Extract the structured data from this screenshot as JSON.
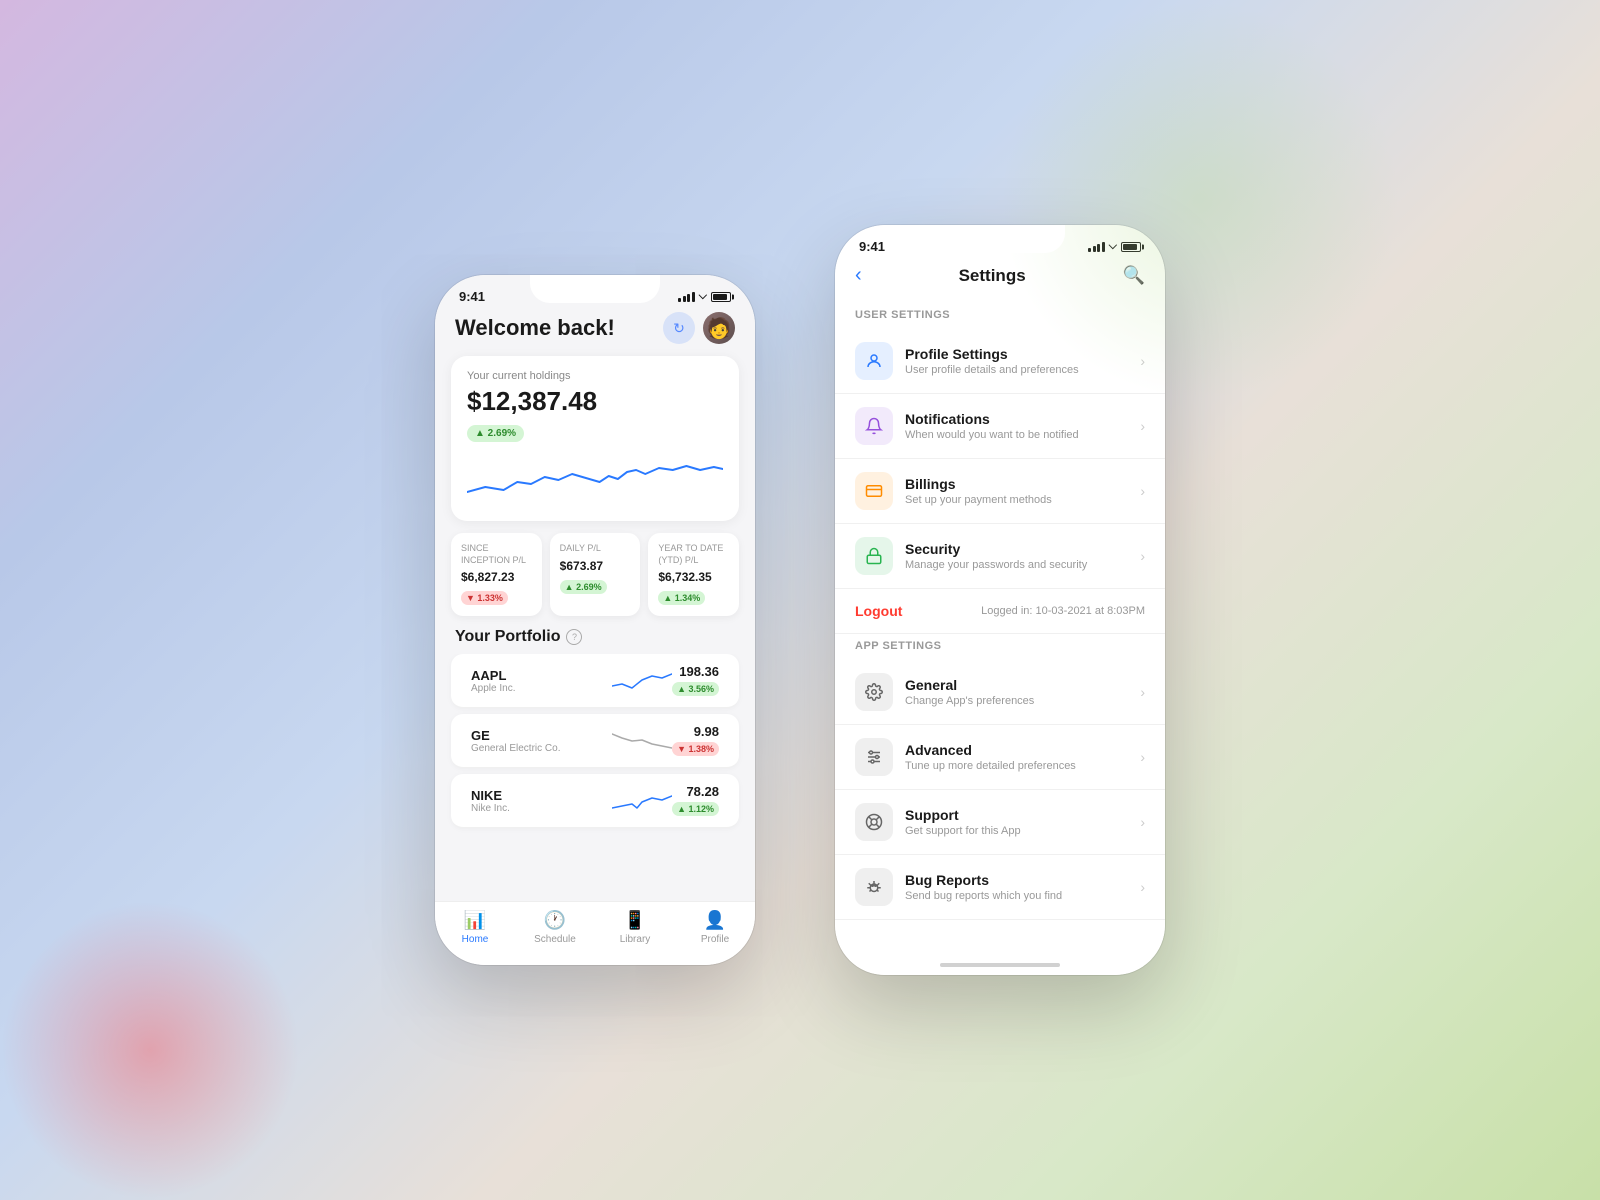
{
  "phone1": {
    "status": {
      "time": "9:41",
      "location_icon": "▸"
    },
    "header": {
      "welcome": "Welcome back!",
      "refresh_icon": "↻"
    },
    "holdings": {
      "label": "Your current holdings",
      "amount": "$12,387.48",
      "change": "▲ 2.69%",
      "change_type": "positive"
    },
    "stats": [
      {
        "label": "SINCE INCEPTION P/L",
        "value": "$6,827.23",
        "change": "▼ 1.33%",
        "type": "negative"
      },
      {
        "label": "DAILY P/L",
        "value": "$673.87",
        "change": "▲ 2.69%",
        "type": "positive"
      },
      {
        "label": "YEAR TO DATE (YTD) P/L",
        "value": "$6,732.35",
        "change": "▲ 1.34%",
        "type": "positive"
      }
    ],
    "portfolio": {
      "title": "Your Portfolio"
    },
    "stocks": [
      {
        "ticker": "AAPL",
        "name": "Apple Inc.",
        "price": "198.36",
        "change": "▲ 3.56%",
        "type": "positive"
      },
      {
        "ticker": "GE",
        "name": "General Electric Co.",
        "price": "9.98",
        "change": "▼ 1.38%",
        "type": "negative"
      },
      {
        "ticker": "NIKE",
        "name": "Nike Inc.",
        "price": "78.28",
        "change": "▲ 1.12%",
        "type": "positive"
      }
    ],
    "bottom_nav": [
      {
        "label": "Home",
        "icon": "📊",
        "active": true
      },
      {
        "label": "Schedule",
        "icon": "🕐",
        "active": false
      },
      {
        "label": "Library",
        "icon": "📱",
        "active": false
      },
      {
        "label": "Profile",
        "icon": "👤",
        "active": false
      }
    ]
  },
  "phone2": {
    "status": {
      "time": "9:41",
      "location_icon": "▸"
    },
    "header": {
      "title": "Settings",
      "back_icon": "‹",
      "search_icon": "⌕"
    },
    "user_settings_label": "USER SETTINGS",
    "app_settings_label": "APP SETTINGS",
    "user_settings": [
      {
        "id": "profile",
        "title": "Profile Settings",
        "subtitle": "User profile details and preferences",
        "icon": "👤",
        "icon_class": "icon-blue"
      },
      {
        "id": "notifications",
        "title": "Notifications",
        "subtitle": "When would you want to be notified",
        "icon": "🔔",
        "icon_class": "icon-purple"
      },
      {
        "id": "billings",
        "title": "Billings",
        "subtitle": "Set up your payment methods",
        "icon": "💳",
        "icon_class": "icon-orange"
      },
      {
        "id": "security",
        "title": "Security",
        "subtitle": "Manage your passwords and security",
        "icon": "🔒",
        "icon_class": "icon-green"
      }
    ],
    "logout": {
      "label": "Logout",
      "logged_in_text": "Logged in: 10-03-2021 at 8:03PM"
    },
    "app_settings": [
      {
        "id": "general",
        "title": "General",
        "subtitle": "Change App's preferences",
        "icon": "⚙️",
        "icon_class": "icon-gray"
      },
      {
        "id": "advanced",
        "title": "Advanced",
        "subtitle": "Tune up more detailed preferences",
        "icon": "⚙",
        "icon_class": "icon-gray"
      },
      {
        "id": "support",
        "title": "Support",
        "subtitle": "Get support for this App",
        "icon": "🛟",
        "icon_class": "icon-gray"
      },
      {
        "id": "bug-reports",
        "title": "Bug Reports",
        "subtitle": "Send bug reports which you find",
        "icon": "🐛",
        "icon_class": "icon-gray"
      }
    ]
  }
}
